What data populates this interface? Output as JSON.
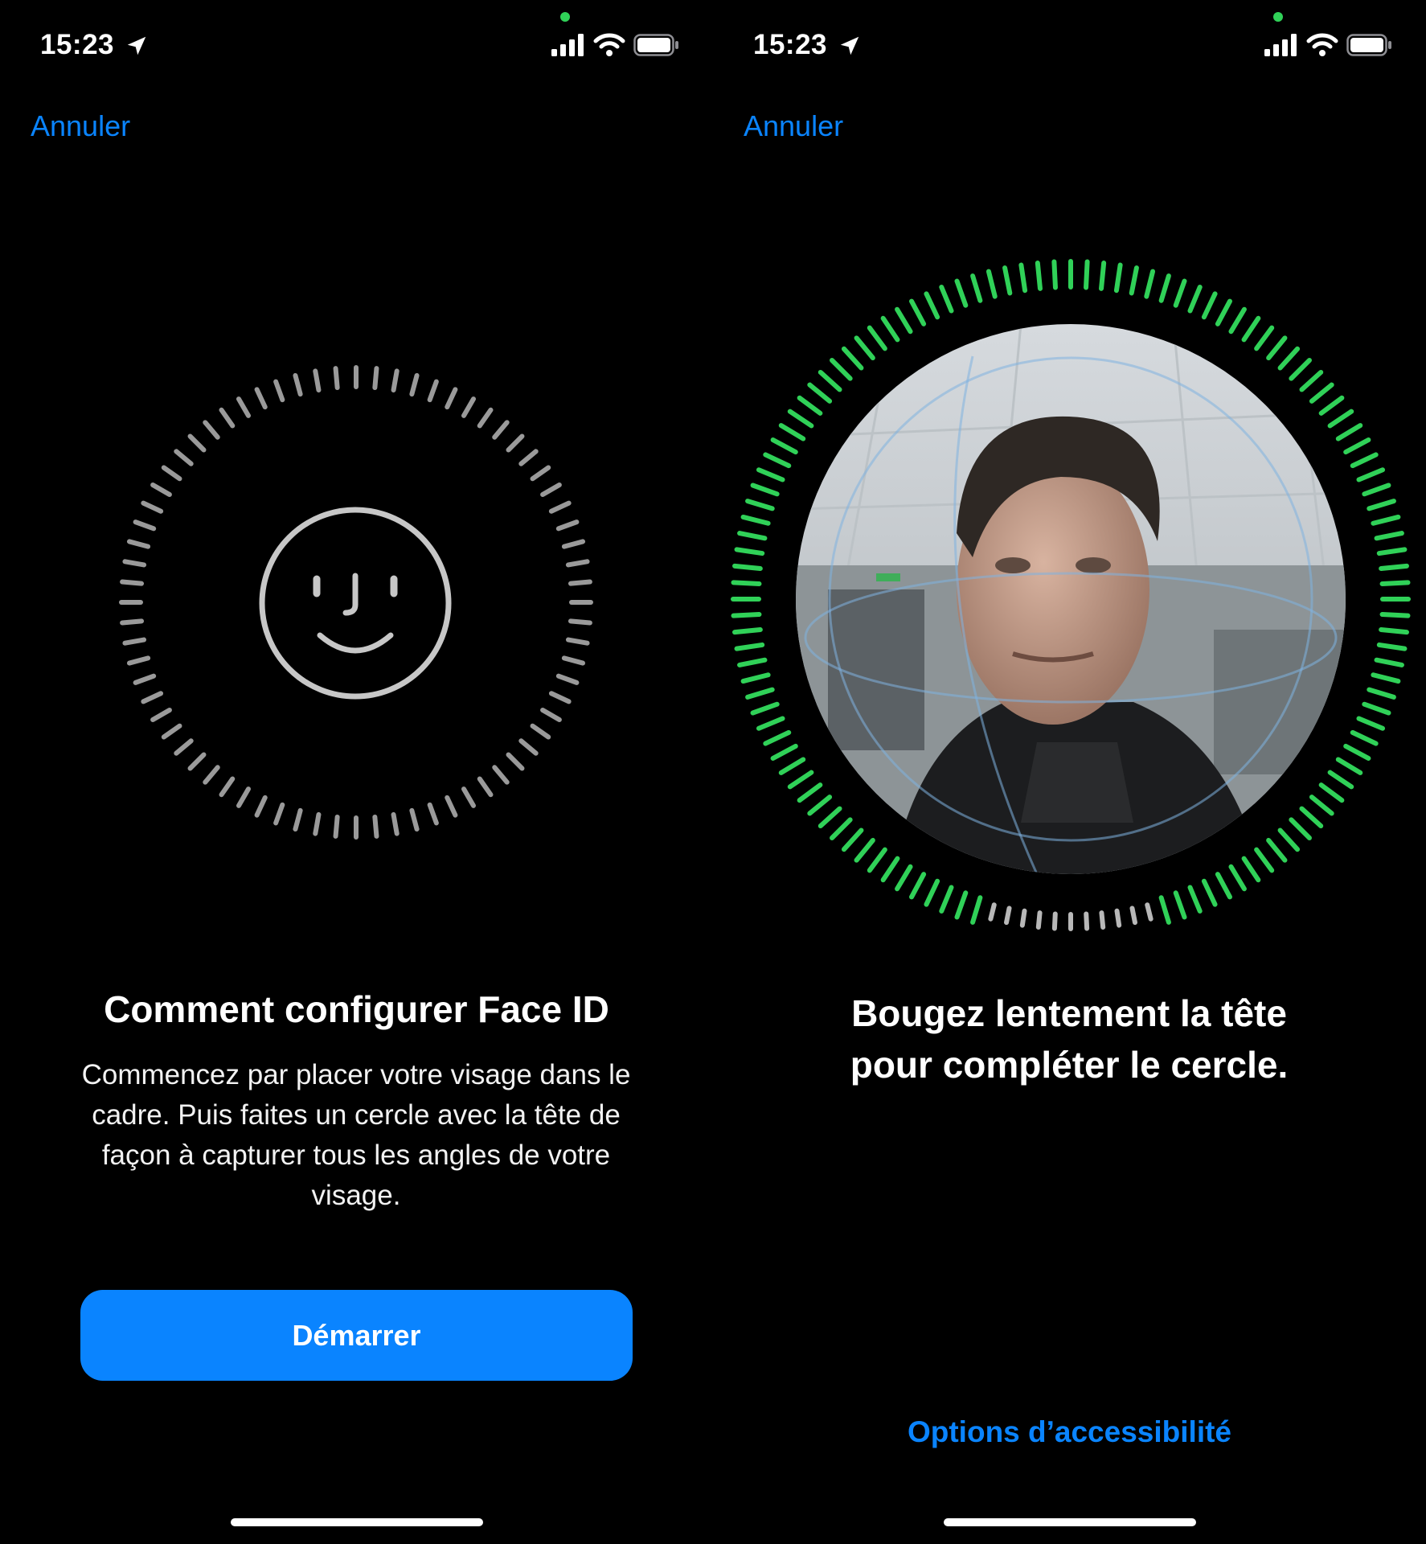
{
  "left": {
    "status": {
      "time": "15:23"
    },
    "cancel_label": "Annuler",
    "title": "Comment configurer Face ID",
    "description": "Commencez par placer votre visage dans le cadre. Puis faites un cercle avec la tête de façon à capturer tous les angles de votre visage.",
    "start_button_label": "Démarrer"
  },
  "right": {
    "status": {
      "time": "15:23"
    },
    "cancel_label": "Annuler",
    "title": "Bougez lentement la tête pour compléter le cercle.",
    "accessibility_label": "Options d’accessibilité",
    "scan_progress": 0.92
  },
  "colors": {
    "accent": "#0a84ff",
    "progress_green": "#30d158",
    "tick_gray": "#9a9a9a",
    "background": "#000000"
  },
  "icons": [
    "location-arrow-icon",
    "signal-icon",
    "wifi-icon",
    "battery-icon",
    "face-id-icon"
  ]
}
